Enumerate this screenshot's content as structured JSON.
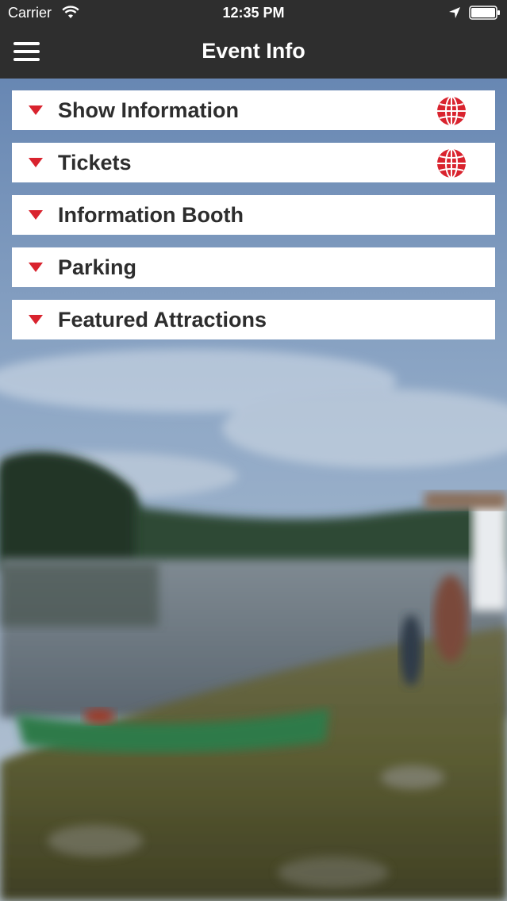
{
  "status_bar": {
    "carrier": "Carrier",
    "time": "12:35 PM",
    "icons": [
      "wifi-icon",
      "location-arrow-icon",
      "battery-icon"
    ]
  },
  "nav": {
    "title": "Event Info",
    "menu_icon": "hamburger-menu-icon"
  },
  "accordion": {
    "items": [
      {
        "label": "Show Information",
        "has_globe": true
      },
      {
        "label": "Tickets",
        "has_globe": true
      },
      {
        "label": "Information Booth",
        "has_globe": false
      },
      {
        "label": "Parking",
        "has_globe": false
      },
      {
        "label": "Featured Attractions",
        "has_globe": false
      }
    ]
  },
  "colors": {
    "bar": "#2e2e2e",
    "accent_red": "#d9232e",
    "item_bg": "#ffffff",
    "item_text": "#2d2d2d"
  }
}
